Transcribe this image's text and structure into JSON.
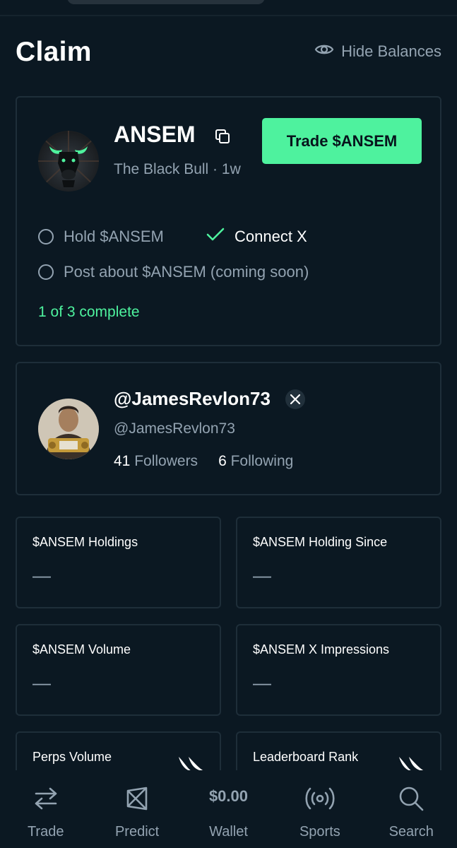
{
  "header": {
    "title": "Claim",
    "hide_balances_label": "Hide Balances",
    "hide_balances_icon": "eye-icon"
  },
  "token_card": {
    "name": "ANSEM",
    "subtitle": "The Black Bull · 1w",
    "trade_label": "Trade $ANSEM",
    "tasks": [
      {
        "label": "Hold $ANSEM",
        "done": false
      },
      {
        "label": "Connect X",
        "done": true
      },
      {
        "label": "Post about $ANSEM (coming soon)",
        "done": false
      }
    ],
    "progress": "1 of 3 complete"
  },
  "profile": {
    "display_handle": "@JamesRevlon73",
    "username": "@JamesRevlon73",
    "followers_count": "41",
    "followers_label": "Followers",
    "following_count": "6",
    "following_label": "Following",
    "badge_icon": "x-logo-icon"
  },
  "stats": [
    {
      "label": "$ANSEM Holdings",
      "value": "—"
    },
    {
      "label": "$ANSEM Holding Since",
      "value": "—"
    },
    {
      "label": "$ANSEM Volume",
      "value": "—"
    },
    {
      "label": "$ANSEM X Impressions",
      "value": "—"
    },
    {
      "label": "Perps Volume",
      "value": ""
    },
    {
      "label": "Leaderboard Rank",
      "value": ""
    }
  ],
  "bottom_nav": [
    {
      "label": "Trade",
      "icon": "arrows-swap-icon"
    },
    {
      "label": "Predict",
      "icon": "predict-icon"
    },
    {
      "label": "Wallet",
      "value": "$0.00"
    },
    {
      "label": "Sports",
      "icon": "broadcast-icon"
    },
    {
      "label": "Search",
      "icon": "search-icon"
    }
  ],
  "colors": {
    "background": "#0b1822",
    "accent": "#4ef29e",
    "muted_text": "#93a3b1",
    "card_border": "#1e2e39"
  }
}
